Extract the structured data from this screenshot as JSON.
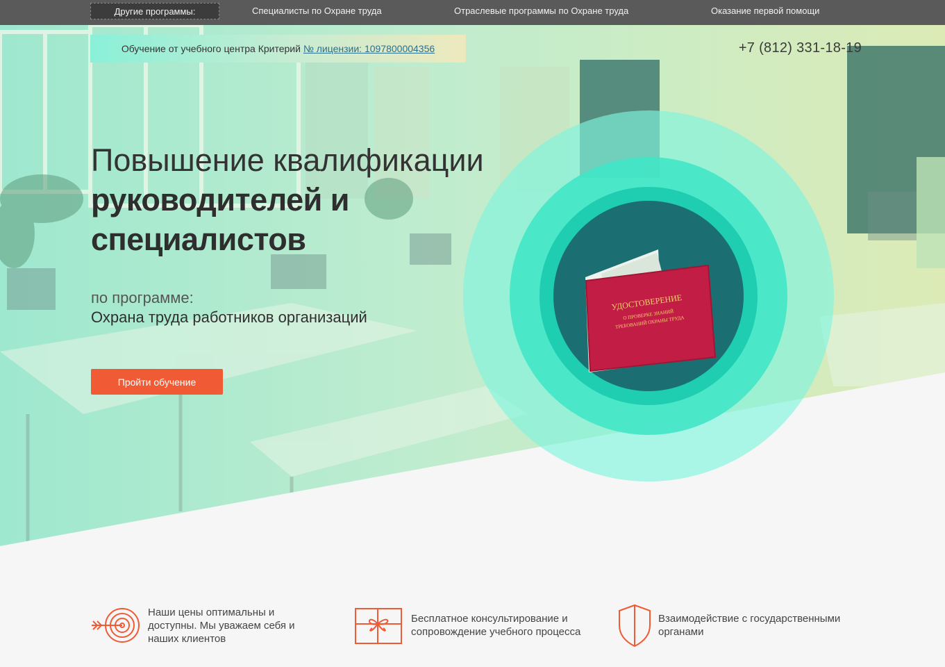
{
  "nav": {
    "items": [
      {
        "label": "Другие программы:"
      },
      {
        "label": "Специалисты по Охране труда"
      },
      {
        "label": "Отраслевые программы по Охране труда"
      },
      {
        "label": "Оказание первой помощи"
      }
    ]
  },
  "license": {
    "text": "Обучение от учебного центра Критерий",
    "link": "№ лицензии: 1097800004356"
  },
  "phone": "+7 (812) 331-18-19",
  "hero": {
    "title_light": "Повышение квалификации",
    "title_bold_1": "руководителей и",
    "title_bold_2": "специалистов",
    "subtitle_small": "по программе:",
    "program": "Охрана труда работников организаций",
    "cta": "Пройти обучение"
  },
  "certificate": {
    "title": "УДОСТОВЕРЕНИЕ",
    "line1": "О ПРОВЕРКЕ ЗНАНИЙ",
    "line2": "ТРЕБОВАНИЙ ОХРАНЫ ТРУДА"
  },
  "features": [
    {
      "icon": "target-arrow-icon",
      "text": "Наши цены оптимальны и доступны. Мы уважаем себя и наших клиентов"
    },
    {
      "icon": "gift-icon",
      "text": "Бесплатное консультирование и сопровождение учебного процесса"
    },
    {
      "icon": "shield-icon",
      "text": "Взаимодействие с государственными органами"
    }
  ],
  "colors": {
    "nav_bg": "#5a5a5a",
    "accent": "#f05a35",
    "teal": "#1fd6b6",
    "dark_teal": "#1b6f72",
    "certificate_red": "#c21e45"
  }
}
